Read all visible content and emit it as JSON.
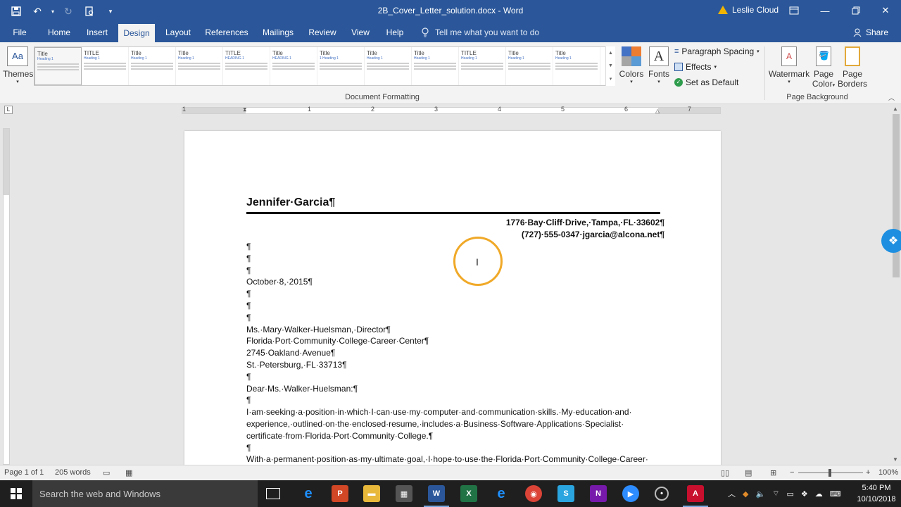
{
  "window": {
    "title": "2B_Cover_Letter_solution.docx - Word",
    "user": "Leslie Cloud"
  },
  "tabs": [
    "File",
    "Home",
    "Insert",
    "Design",
    "Layout",
    "References",
    "Mailings",
    "Review",
    "View",
    "Help"
  ],
  "active_tab": "Design",
  "tell_me": "Tell me what you want to do",
  "share": "Share",
  "ribbon": {
    "themes": "Themes",
    "gallery": [
      {
        "title": "Title",
        "heading": "Heading 1"
      },
      {
        "title": "TITLE",
        "heading": "Heading 1"
      },
      {
        "title": "Title",
        "heading": "Heading 1"
      },
      {
        "title": "Title",
        "heading": "Heading 1"
      },
      {
        "title": "TITLE",
        "heading": "HEADING 1"
      },
      {
        "title": "Title",
        "heading": "HEADING 1"
      },
      {
        "title": "Title",
        "heading": "1 Heading 1"
      },
      {
        "title": "Title",
        "heading": "Heading 1"
      },
      {
        "title": "Title",
        "heading": "Heading 1"
      },
      {
        "title": "TITLE",
        "heading": "Heading 1"
      },
      {
        "title": "Title",
        "heading": "Heading 1"
      },
      {
        "title": "Title",
        "heading": "Heading 1"
      }
    ],
    "colors": "Colors",
    "fonts": "Fonts",
    "paragraph_spacing": "Paragraph Spacing",
    "effects": "Effects",
    "set_as_default": "Set as Default",
    "watermark": "Watermark",
    "page_color": [
      "Page",
      "Color"
    ],
    "page_borders": [
      "Page",
      "Borders"
    ],
    "group_document_formatting": "Document Formatting",
    "group_page_background": "Page Background"
  },
  "ruler_numbers": [
    "1",
    "1",
    "2",
    "3",
    "4",
    "5",
    "6",
    "7"
  ],
  "document": {
    "name": "Jennifer·Garcia¶",
    "address_1": "1776·Bay·Cliff·Drive,·Tampa,·FL·33602¶",
    "address_2": "(727)·555-0347·jgarcia@alcona.net¶",
    "lines": [
      "¶",
      "¶",
      "¶",
      "October·8,·2015¶",
      "¶",
      "¶",
      "¶",
      "Ms.·Mary·Walker-Huelsman,·Director¶",
      "Florida·Port·Community·College·Career·Center¶",
      "2745·Oakland·Avenue¶",
      "St.·Petersburg,·FL·33713¶",
      "¶",
      "Dear·Ms.·Walker-Huelsman:¶",
      "¶"
    ],
    "para_1": "I·am·seeking·a·position·in·which·I·can·use·my·computer·and·communication·skills.·My·education·and· experience,·outlined·on·the·enclosed·resume,·includes·a·Business·Software·Applications·Specialist· certificate·from·Florida·Port·Community·College.¶",
    "blank": "¶",
    "para_2": "With·a·permanent·position·as·my·ultimate·goal,·I·hope·to·use·the·Florida·Port·Community·College·Career·"
  },
  "status": {
    "page": "Page 1 of 1",
    "words": "205 words",
    "zoom": "100%"
  },
  "taskbar": {
    "search": "Search the web and Windows",
    "time": "5:40 PM",
    "date": "10/10/2018"
  }
}
